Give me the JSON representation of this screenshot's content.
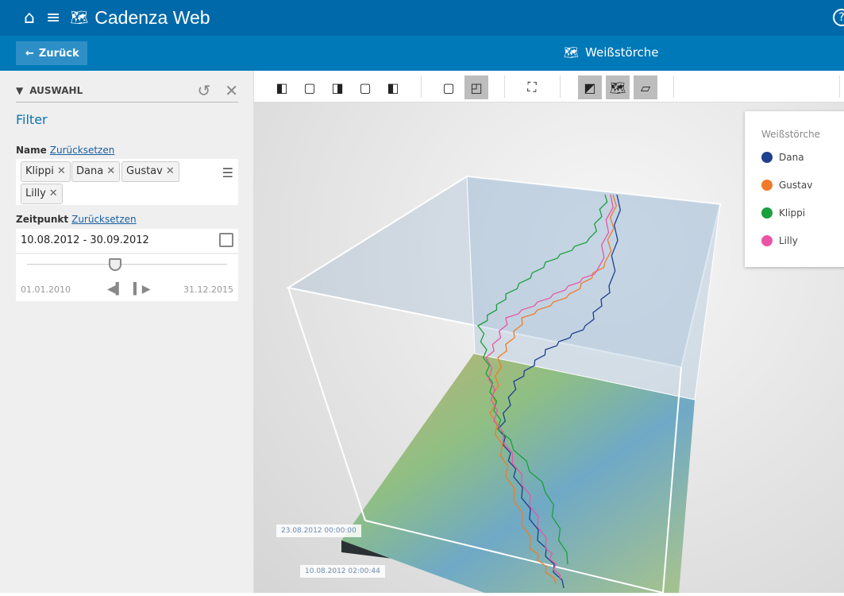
{
  "header": {
    "title": "Cadenza Web",
    "help": "?"
  },
  "subbar": {
    "back_label": "Zurück",
    "view_title": "Weißstörche"
  },
  "sidebar": {
    "title": "AUSWAHL",
    "filter_heading": "Filter",
    "name_label": "Name",
    "name_reset": "Zurücksetzen",
    "tags": [
      "Klippi",
      "Dana",
      "Gustav",
      "Lilly"
    ],
    "time_label": "Zeitpunkt",
    "time_reset": "Zurücksetzen",
    "date_range": "10.08.2012 - 30.09.2012",
    "slider_min": "01.01.2010",
    "slider_max": "31.12.2015",
    "slider_position": 0.44
  },
  "legend": {
    "title": "Weißstörche",
    "items": [
      {
        "label": "Dana",
        "color": "#1f3f8f"
      },
      {
        "label": "Gustav",
        "color": "#f07b2a"
      },
      {
        "label": "Klippi",
        "color": "#1aa03c"
      },
      {
        "label": "Lilly",
        "color": "#e855a6"
      }
    ]
  },
  "scene": {
    "time_top": "23.08.2012 00:00:00",
    "time_bottom": "10.08.2012 02:00:44"
  }
}
